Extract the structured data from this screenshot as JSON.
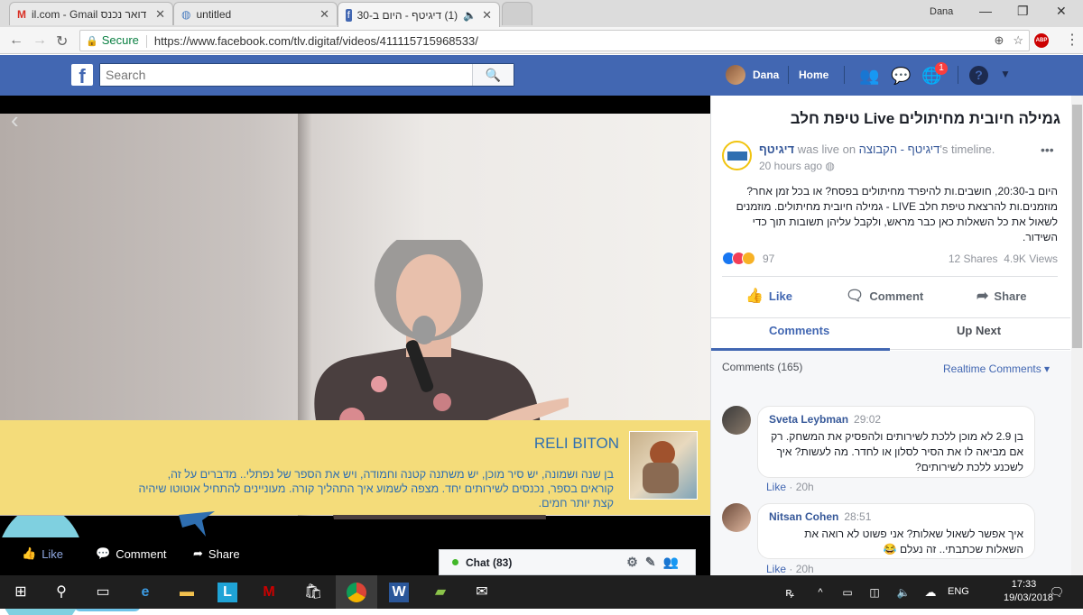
{
  "browser": {
    "tabs": [
      {
        "label": "il.com - Gmail דואר נכנס",
        "icon": "gmail-icon"
      },
      {
        "label": "untitled",
        "icon": "globe-icon"
      },
      {
        "label": "(1) דיגיטף - היום ב-30",
        "icon": "facebook-icon"
      }
    ],
    "user": "Dana",
    "secure_label": "Secure",
    "url": "https://www.facebook.com/tlv.digitaf/videos/411115715968533/"
  },
  "fb": {
    "search_placeholder": "Search",
    "profile_name": "Dana",
    "home_label": "Home",
    "notif_count": "1"
  },
  "video": {
    "speaker_name": "RELI BITON",
    "speaker_bio": "בן שנה ושמונה, יש סיר מוכן, יש משתנה קטנה וחמודה, ויש את הספר של נפתלי.. מדברים על זה, קוראים בספר, נכנסים לשירותים יחד. מצפה לשמוע איך התהליך קורה. מעוניינים להתחיל אוטוטו שיהיה קצת יותר חמים.",
    "like_label": "Like",
    "comment_label": "Comment",
    "share_label": "Share",
    "chat_label": "Chat (83)"
  },
  "post": {
    "title": "גמילה חיובית מחיתולים Live טיפת חלב",
    "page_name": "דיגיטף",
    "was_live": "was live on",
    "group_name": "דיגיטף - הקבוצה",
    "timeline": "'s timeline.",
    "time": "20 hours ago",
    "description": "היום ב-20:30, חושבים.ות להיפרד מחיתולים בפסח? או בכל זמן אחר? מוזמנים.ות להרצאת טיפת חלב LIVE - גמילה חיובית מחיתולים. מוזמנים לשאול את כל השאלות כאן כבר מראש, ולקבל עליהן תשובות תוך כדי השידור.",
    "reaction_count": "97",
    "shares": "12 Shares",
    "views": "4.9K Views",
    "like_label": "Like",
    "comment_label": "Comment",
    "share_label": "Share",
    "tab_comments": "Comments",
    "tab_upnext": "Up Next",
    "comments_count": "Comments (165)",
    "realtime_label": "Realtime Comments ▾"
  },
  "comments": [
    {
      "name": "Sveta Leybman",
      "time": "29:02",
      "text": "בן 2.9 לא מוכן ללכת לשירותים ולהפסיק את המשחק. רק אם מביאה לו את הסיר לסלון או לחדר. מה לעשות? איך לשכנע ללכת לשירותים?",
      "like": "Like",
      "age": "20h"
    },
    {
      "name": "Nitsan Cohen",
      "time": "28:51",
      "text": "איך אפשר לשאול שאלות? אני פשוט לא רואה את השאלות שכתבתי.. זה נעלם 😂",
      "like": "Like",
      "age": "20h"
    }
  ],
  "taskbar": {
    "time": "17:33",
    "date": "19/03/2018",
    "lang": "ENG"
  },
  "colors": {
    "fb_blue": "#4267b2",
    "banner_yellow": "#f4dc7a",
    "taskbar": "#1f1f1f"
  }
}
